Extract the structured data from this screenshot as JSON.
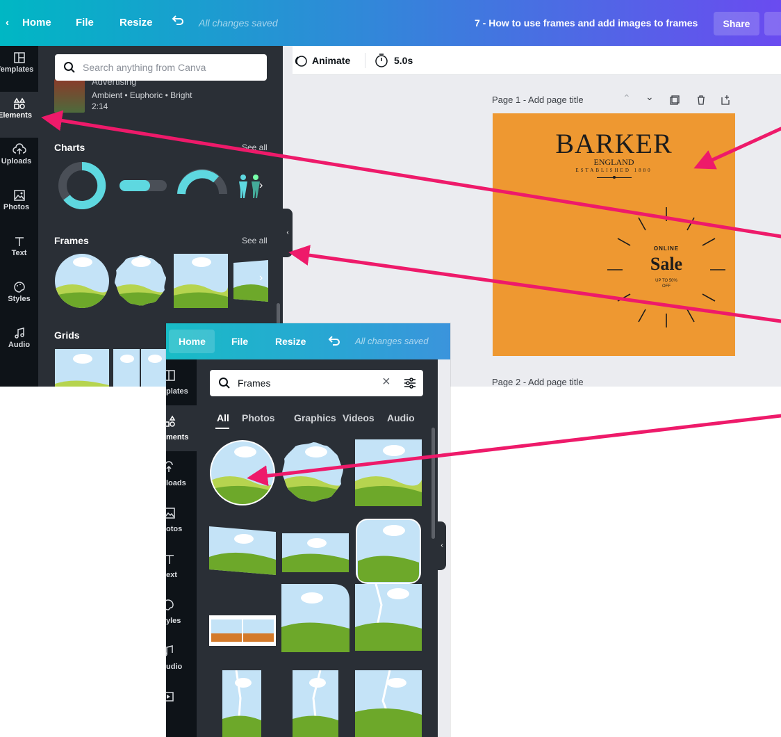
{
  "colors": {
    "arrow": "#ee1a6a",
    "design_bg": "#ee9831",
    "panel_bg": "#2a2f36",
    "rail_bg": "#0e1318",
    "sky": "#b8dcf5",
    "grass": "#7cb52e"
  },
  "bg_screen": {
    "topbar": {
      "home": "Home",
      "file": "File",
      "resize": "Resize",
      "saved": "All changes saved",
      "doc_title": "7 - How to use frames and add images to frames",
      "share": "Share"
    },
    "rail": [
      {
        "label": "Templates",
        "icon": "templates-icon"
      },
      {
        "label": "Elements",
        "icon": "elements-icon"
      },
      {
        "label": "Uploads",
        "icon": "uploads-icon"
      },
      {
        "label": "Photos",
        "icon": "photos-icon"
      },
      {
        "label": "Text",
        "icon": "text-icon"
      },
      {
        "label": "Styles",
        "icon": "styles-icon"
      },
      {
        "label": "Audio",
        "icon": "audio-icon"
      }
    ],
    "search_placeholder": "Search anything from Canva",
    "audio_item": {
      "title": "Advertising",
      "tags": "Ambient • Euphoric • Bright",
      "duration": "2:14"
    },
    "sections": {
      "charts": "Charts",
      "frames": "Frames",
      "grids": "Grids",
      "see_all": "See all"
    },
    "toolbar": {
      "animate": "Animate",
      "duration": "5.0s"
    },
    "page1_label": "Page 1",
    "page1_title_placeholder": "- Add page title",
    "page2_label": "Page 2 - Add page title",
    "design": {
      "brand": "BARKER",
      "country": "ENGLAND",
      "established": "ESTABLISHED 1880",
      "online": "ONLINE",
      "sale": "Sale",
      "discount_line1": "UP TO 50%",
      "discount_line2": "OFF"
    }
  },
  "fg_screen": {
    "topbar": {
      "home": "Home",
      "file": "File",
      "resize": "Resize",
      "saved": "All changes saved"
    },
    "rail": [
      {
        "label": "plates",
        "icon": "templates-icon"
      },
      {
        "label": "ments",
        "icon": "elements-icon"
      },
      {
        "label": "loads",
        "icon": "uploads-icon"
      },
      {
        "label": "otos",
        "icon": "photos-icon"
      },
      {
        "label": "ext",
        "icon": "text-icon"
      },
      {
        "label": "yles",
        "icon": "styles-icon"
      },
      {
        "label": "udio",
        "icon": "audio-icon"
      }
    ],
    "search_value": "Frames",
    "tabs": [
      "All",
      "Photos",
      "Graphics",
      "Videos",
      "Audio"
    ],
    "active_tab": "All"
  }
}
